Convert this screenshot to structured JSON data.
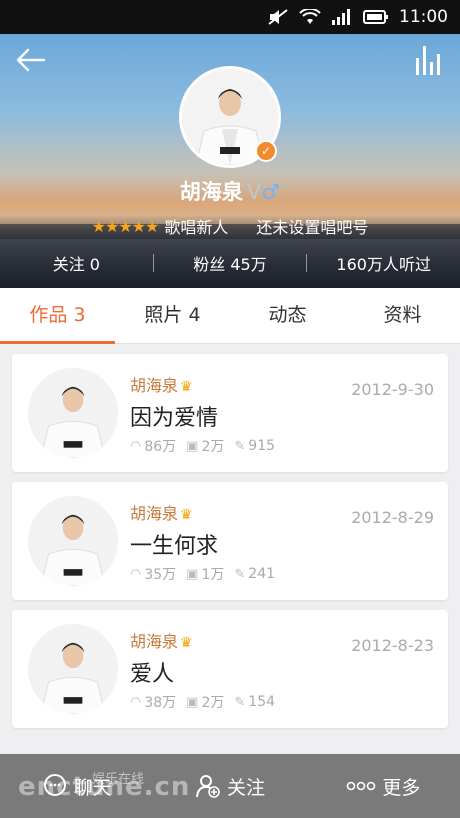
{
  "status_bar": {
    "time": "11:00"
  },
  "profile": {
    "name": "胡海泉",
    "verified_mark": "V",
    "gender_symbol": "♂",
    "stars": "★★★★★",
    "level": "歌唱新人",
    "bar_id": "还未设置唱吧号"
  },
  "stats": {
    "following": "关注 0",
    "fans": "粉丝 45万",
    "listeners": "160万人听过"
  },
  "tabs": [
    {
      "label": "作品 3",
      "active": true
    },
    {
      "label": "照片 4",
      "active": false
    },
    {
      "label": "动态",
      "active": false
    },
    {
      "label": "资料",
      "active": false
    }
  ],
  "works": [
    {
      "author": "胡海泉",
      "date": "2012-9-30",
      "title": "因为爱情",
      "listens": "86万",
      "gifts": "2万",
      "comments": "915"
    },
    {
      "author": "胡海泉",
      "date": "2012-8-29",
      "title": "一生何求",
      "listens": "35万",
      "gifts": "1万",
      "comments": "241"
    },
    {
      "author": "胡海泉",
      "date": "2012-8-23",
      "title": "爱人",
      "listens": "38万",
      "gifts": "2万",
      "comments": "154"
    }
  ],
  "bottom_bar": {
    "chat": "聊天",
    "follow": "关注",
    "more": "更多"
  },
  "watermark": {
    "main": "enctune.cn",
    "sub": "娱乐在线"
  },
  "icons": {
    "back": "back-arrow-icon",
    "chart": "equalizer-icon",
    "badge": "verified-check-icon",
    "listen": "headphone-icon",
    "gift": "gift-icon",
    "comment": "comment-icon",
    "chat": "chat-bubble-icon",
    "follow": "add-user-icon",
    "more": "more-dots-icon"
  },
  "colors": {
    "accent": "#ee6a36",
    "author": "#c87a3a",
    "star": "#f8a31f"
  }
}
